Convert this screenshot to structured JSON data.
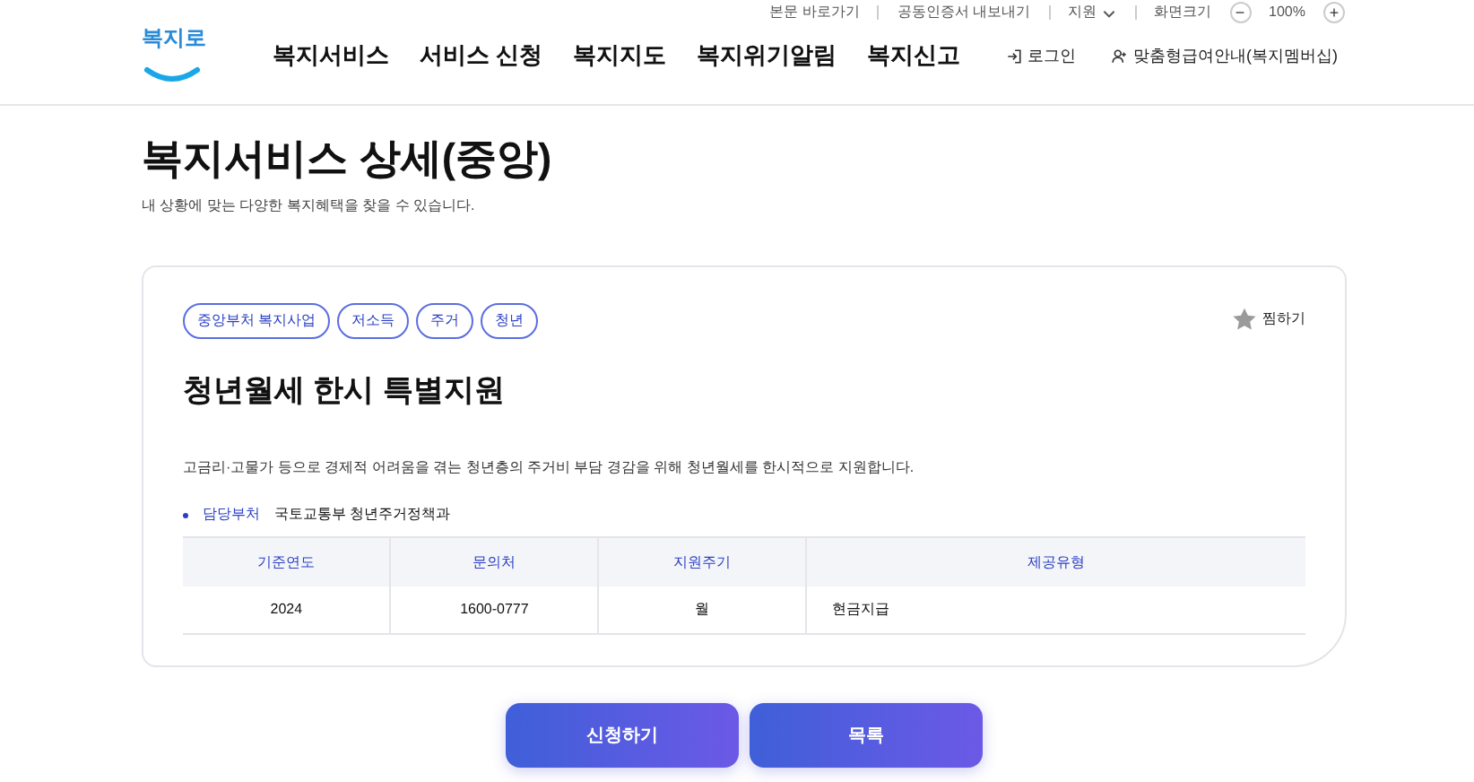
{
  "utility_links": [
    {
      "label": "본문 바로가기",
      "kind": "link"
    },
    {
      "label": "공동인증서 내보내기",
      "kind": "link"
    },
    {
      "label": "지원",
      "kind": "dropdown"
    }
  ],
  "zoom": {
    "label": "화면크기",
    "minus": "−",
    "value": "100%",
    "plus": "+"
  },
  "logo": {
    "text": "복지로"
  },
  "nav": [
    "복지서비스",
    "서비스 신청",
    "복지지도",
    "복지위기알림",
    "복지신고"
  ],
  "header_actions": [
    {
      "label": "로그인",
      "kind": "login"
    },
    {
      "label": "맞춤형급여안내(복지멤버십)",
      "kind": "membership"
    }
  ],
  "page": {
    "title": "복지서비스 상세(중앙)",
    "subtitle": "내 상황에 맞는 다양한 복지혜택을 찾을 수 있습니다."
  },
  "service": {
    "tags": [
      "중앙부처 복지사업",
      "저소득",
      "주거",
      "청년"
    ],
    "bookmark": {
      "label": "찜하기",
      "checked": false
    },
    "title": "청년월세 한시 특별지원",
    "description": "고금리·고물가 등으로 경제적 어려움을 겪는 청년층의 주거비 부담 경감을 위해 청년월세를 한시적으로 지원합니다.",
    "department": {
      "label": "담당부처",
      "value": "국토교통부 청년주거정책과"
    },
    "table": {
      "columns": [
        "기준연도",
        "문의처",
        "지원주기",
        "제공유형"
      ],
      "rows": [
        [
          "2024",
          "1600-0777",
          "월",
          "현금지급"
        ]
      ]
    }
  },
  "buttons": [
    "신청하기",
    "목록"
  ]
}
